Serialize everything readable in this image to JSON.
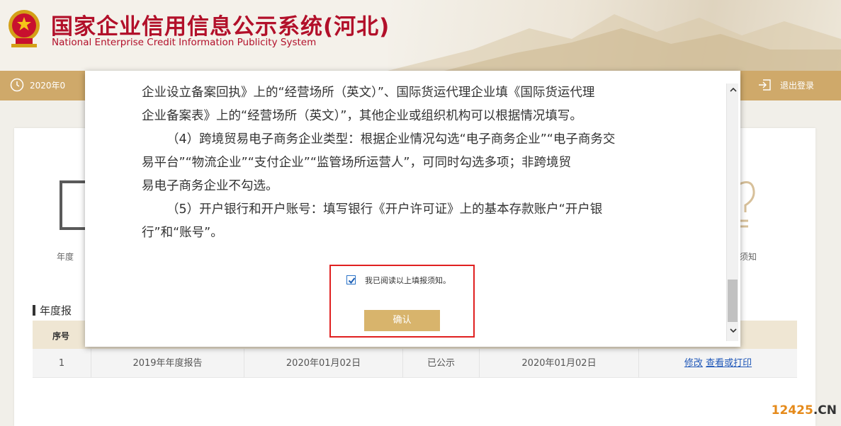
{
  "header": {
    "title": "国家企业信用信息公示系统",
    "province": "(河北)",
    "subtitle": "National Enterprise Credit Information Publicity System"
  },
  "navbar": {
    "date": "2020年0",
    "logout": "退出登录"
  },
  "page": {
    "left_label": "年度",
    "right_label": "须知",
    "section_title": "年度报",
    "table": {
      "header_first": "序号",
      "row": {
        "index": "1",
        "report": "2019年年度报告",
        "date1": "2020年01月02日",
        "status": "已公示",
        "date2": "2020年01月02日",
        "action_edit": "修改",
        "action_view": "查看或打印"
      }
    }
  },
  "modal": {
    "lines": [
      "企业设立备案回执》上的“经营场所（英文）”、国际货运代理企业填《国际货运代理",
      "企业备案表》上的“经营场所（英文）”，其他企业或组织机构可以根据情况填写。",
      "（4）跨境贸易电子商务企业类型：根据企业情况勾选“电子商务企业”“电子商务交",
      "易平台”“物流企业”“支付企业”“监管场所运营人”，可同时勾选多项；非跨境贸",
      "易电子商务企业不勾选。",
      "（5）开户银行和开户账号：填写银行《开户许可证》上的基本存款账户“开户银",
      "行”和“账号”。"
    ],
    "checkbox_label": "我已阅读以上填报须知。",
    "confirm_label": "确认"
  },
  "watermark": {
    "number": "12425",
    "dot": ".",
    "tld": "CN"
  },
  "colors": {
    "brand_red": "#b2102a",
    "nav_gold": "#cfa96a",
    "button_gold": "#d8b46c",
    "highlight_red": "#e02020"
  }
}
